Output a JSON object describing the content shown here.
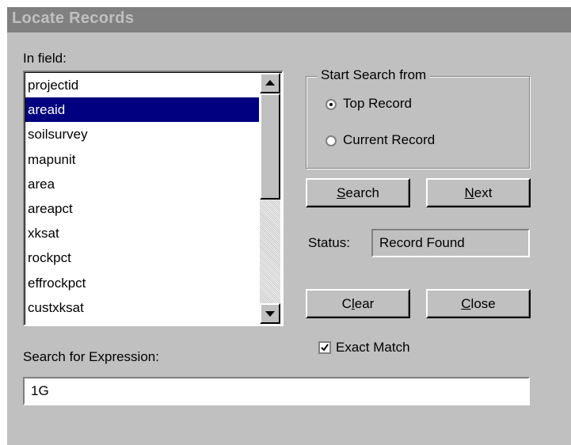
{
  "dialog": {
    "title": "Locate Records",
    "in_field_label": "In field:",
    "fields": [
      "projectid",
      "areaid",
      "soilsurvey",
      "mapunit",
      "area",
      "areapct",
      "xksat",
      "rockpct",
      "effrockpct",
      "custxksat"
    ],
    "selected_field": "areaid",
    "start_group": {
      "legend": "Start Search from",
      "options": [
        "Top Record",
        "Current Record"
      ],
      "selected": "Top Record"
    },
    "buttons": {
      "search": {
        "pre": "",
        "key": "S",
        "post": "earch"
      },
      "next": {
        "pre": "",
        "key": "N",
        "post": "ext"
      },
      "clear": {
        "pre": "C",
        "key": "l",
        "post": "ear"
      },
      "close": {
        "pre": "",
        "key": "C",
        "post": "lose"
      }
    },
    "status_label": "Status:",
    "status_value": "Record Found",
    "exact_match_label": "Exact Match",
    "exact_match_checked": true,
    "search_expr_label": "Search for Expression:",
    "search_expr_value": "1G"
  }
}
